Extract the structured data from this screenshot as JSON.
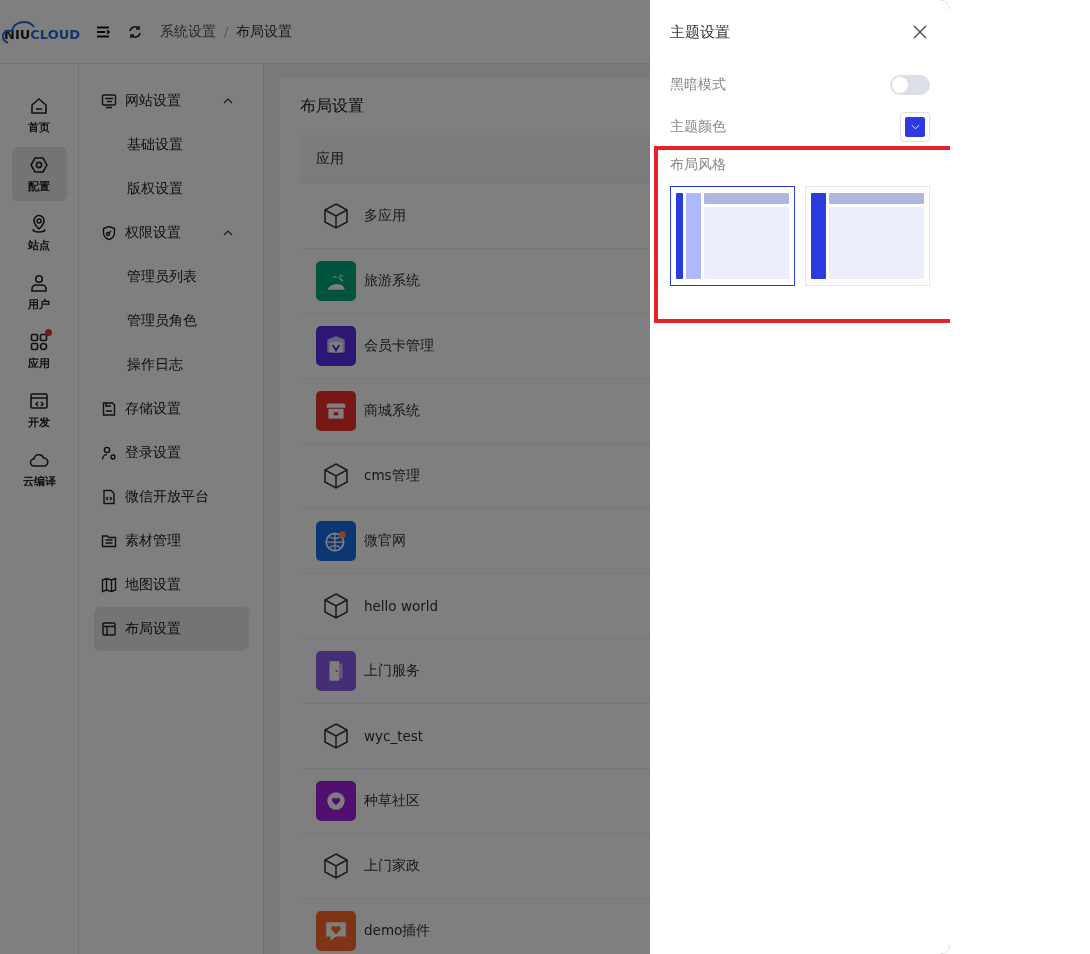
{
  "header": {
    "logo": {
      "dark": "NIU",
      "accent": "CLOUD"
    },
    "breadcrumb": [
      "系统设置",
      "布局设置"
    ],
    "separator": "/"
  },
  "rail": [
    {
      "label": "首页",
      "kind": "home",
      "selected": false,
      "dot": false
    },
    {
      "label": "配置",
      "kind": "hexagon",
      "selected": true,
      "dot": false
    },
    {
      "label": "站点",
      "kind": "pin",
      "selected": false,
      "dot": false
    },
    {
      "label": "用户",
      "kind": "user",
      "selected": false,
      "dot": false
    },
    {
      "label": "应用",
      "kind": "grid",
      "selected": false,
      "dot": true
    },
    {
      "label": "开发",
      "kind": "code",
      "selected": false,
      "dot": false
    },
    {
      "label": "云编译",
      "kind": "cloud",
      "selected": false,
      "dot": false
    }
  ],
  "menu": [
    {
      "label": "网站设置",
      "kind": "monitor",
      "expanded": true,
      "selected": false,
      "children": [
        {
          "label": "基础设置",
          "selected": false
        },
        {
          "label": "版权设置",
          "selected": false
        }
      ]
    },
    {
      "label": "权限设置",
      "kind": "shield",
      "expanded": true,
      "selected": false,
      "children": [
        {
          "label": "管理员列表",
          "selected": false
        },
        {
          "label": "管理员角色",
          "selected": false
        },
        {
          "label": "操作日志",
          "selected": false
        }
      ]
    },
    {
      "label": "存储设置",
      "kind": "disk",
      "selected": false
    },
    {
      "label": "登录设置",
      "kind": "usergear",
      "selected": false
    },
    {
      "label": "微信开放平台",
      "kind": "file",
      "selected": false
    },
    {
      "label": "素材管理",
      "kind": "folder",
      "selected": false
    },
    {
      "label": "地图设置",
      "kind": "map",
      "selected": false
    },
    {
      "label": "布局设置",
      "kind": "layout",
      "selected": true
    }
  ],
  "page": {
    "title": "布局设置",
    "table": {
      "columns": [
        "应用"
      ],
      "rows": [
        {
          "name": "多应用",
          "kind": "cube"
        },
        {
          "name": "旅游系统",
          "kind": "palm"
        },
        {
          "name": "会员卡管理",
          "kind": "badge"
        },
        {
          "name": "商城系统",
          "kind": "shop"
        },
        {
          "name": "cms管理",
          "kind": "cube"
        },
        {
          "name": "微官网",
          "kind": "globe"
        },
        {
          "name": "hello world",
          "kind": "cube"
        },
        {
          "name": "上门服务",
          "kind": "door"
        },
        {
          "name": "wyc_test",
          "kind": "cube"
        },
        {
          "name": "种草社区",
          "kind": "heart"
        },
        {
          "name": "上门家政",
          "kind": "cube"
        },
        {
          "name": "demo插件",
          "kind": "chat"
        }
      ]
    }
  },
  "drawer": {
    "title": "主题设置",
    "dark_mode": {
      "label": "黑暗模式",
      "on": false
    },
    "theme_color": {
      "label": "主题颜色",
      "color": "#2a3ce0"
    },
    "layout_style": {
      "label": "布局风格",
      "options": [
        {
          "kind": "double",
          "selected": true
        },
        {
          "kind": "single",
          "selected": false
        }
      ]
    }
  }
}
